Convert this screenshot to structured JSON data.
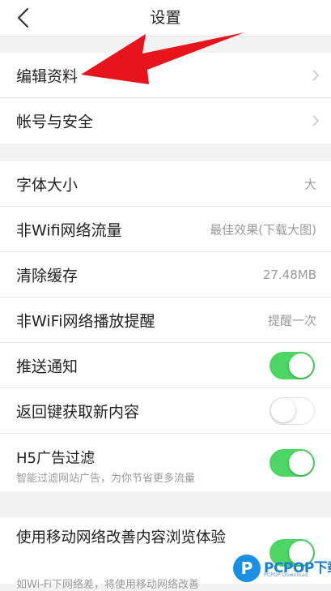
{
  "header": {
    "title": "设置",
    "back_icon": "chevron-left-icon"
  },
  "group1": {
    "items": [
      {
        "label": "编辑资料",
        "icon": "chevron-right-icon"
      },
      {
        "label": "帐号与安全",
        "icon": "chevron-right-icon"
      }
    ]
  },
  "group2": {
    "items": [
      {
        "label": "字体大小",
        "value": "大"
      },
      {
        "label": "非Wifi网络流量",
        "value": "最佳效果(下载大图)"
      },
      {
        "label": "清除缓存",
        "value": "27.48MB"
      },
      {
        "label": "非WiFi网络播放提醒",
        "value": "提醒一次"
      },
      {
        "label": "推送通知",
        "toggle": true
      },
      {
        "label": "返回键获取新内容",
        "toggle": false
      },
      {
        "label": "H5广告过滤",
        "sub": "智能过滤网站广告，为你节省更多流量",
        "toggle": true
      },
      {
        "label": "使用移动网络改善内容浏览体验",
        "sub": "如Wi-Fi下网络差，将使用移动网络改善",
        "toggle": true
      }
    ]
  },
  "annotation": {
    "arrow_color": "#e8141c"
  },
  "watermark": {
    "brand": "PCPOP下载",
    "sub": "PCPOP Download"
  },
  "colors": {
    "toggle_on": "#4cd664",
    "background": "#f2f2f2"
  }
}
